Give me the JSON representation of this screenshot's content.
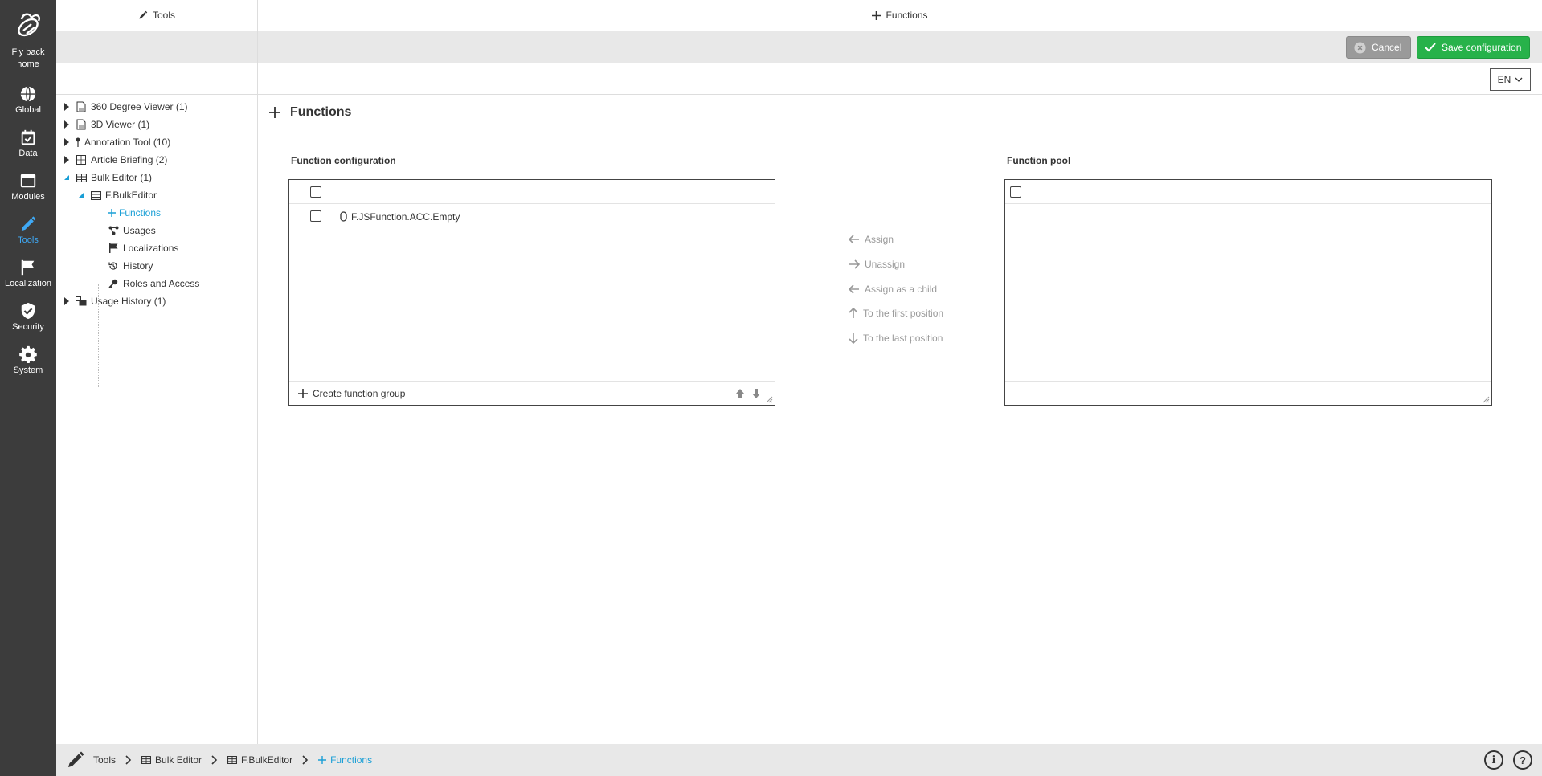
{
  "rail": {
    "home_label": "Fly back home",
    "items": [
      {
        "label": "Global",
        "icon": "globe-icon"
      },
      {
        "label": "Data",
        "icon": "calendar-check-icon"
      },
      {
        "label": "Modules",
        "icon": "window-icon"
      },
      {
        "label": "Tools",
        "icon": "pencil-icon",
        "active": true
      },
      {
        "label": "Localization",
        "icon": "flag-icon"
      },
      {
        "label": "Security",
        "icon": "shield-check-icon"
      },
      {
        "label": "System",
        "icon": "gear-icon"
      }
    ]
  },
  "tree_panel": {
    "header": "Tools",
    "nodes": [
      {
        "label": "360 Degree Viewer (1)"
      },
      {
        "label": "3D Viewer (1)"
      },
      {
        "label": "Annotation Tool (10)"
      },
      {
        "label": "Article Briefing (2)"
      },
      {
        "label": "Bulk Editor (1)"
      },
      {
        "label": "F.BulkEditor"
      },
      {
        "label": "Functions"
      },
      {
        "label": "Usages"
      },
      {
        "label": "Localizations"
      },
      {
        "label": "History"
      },
      {
        "label": "Roles and Access"
      },
      {
        "label": "Usage History (1)"
      }
    ]
  },
  "main": {
    "header": "Functions",
    "cancel_label": "Cancel",
    "save_label": "Save configuration",
    "language": "EN",
    "page_title": "Functions",
    "config_label": "Function configuration",
    "pool_label": "Function pool",
    "config_rows": [
      {
        "label": "F.JSFunction.ACC.Empty"
      }
    ],
    "create_group_label": "Create function group",
    "actions": {
      "assign": "Assign",
      "unassign": "Unassign",
      "assign_child": "Assign as a child",
      "first": "To the first position",
      "last": "To the last position"
    }
  },
  "breadcrumb": {
    "items": [
      "Tools",
      "Bulk Editor",
      "F.BulkEditor",
      "Functions"
    ]
  },
  "colors": {
    "rail_bg": "#3c3c3c",
    "accent": "#1a9fd6",
    "save_green": "#27b24a",
    "cancel_gray": "#9a9a9a"
  }
}
